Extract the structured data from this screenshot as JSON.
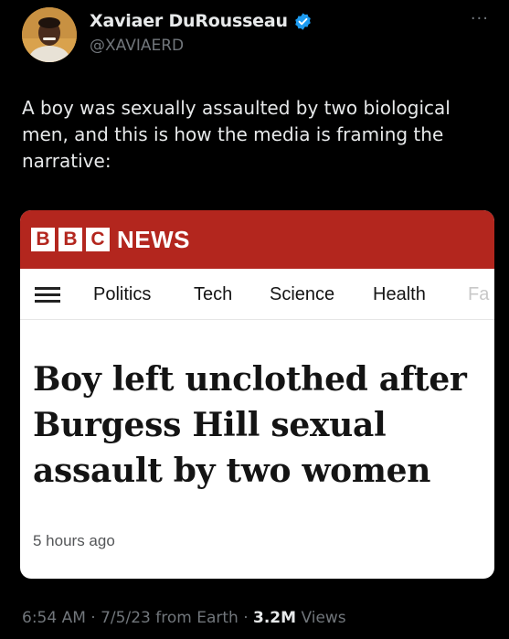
{
  "author": {
    "display_name": "Xaviaer DuRousseau",
    "handle": "@XAVIAERD",
    "verified": true
  },
  "tweet": {
    "text": "A boy was sexually assaulted by two biological men, and this is how the media is framing the narrative:"
  },
  "embedded_image": {
    "brand_letters": [
      "B",
      "B",
      "C"
    ],
    "brand_word": "NEWS",
    "nav_items": [
      "Politics",
      "Tech",
      "Science",
      "Health",
      "Fa"
    ],
    "headline": "Boy left unclothed after Burgess Hill sexual assault by two women",
    "age": "5 hours ago"
  },
  "meta": {
    "time": "6:54 AM",
    "date": "7/5/23",
    "source": "from Earth",
    "views_count": "3.2M",
    "views_label": "Views"
  },
  "colors": {
    "background": "#000000",
    "bbc_red": "#b3261e",
    "verified_blue": "#1d9bf0",
    "muted_text": "#71767b"
  }
}
